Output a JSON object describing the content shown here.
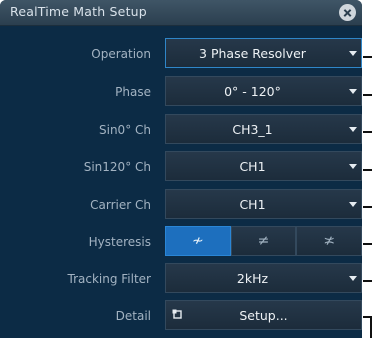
{
  "title": "RealTime Math Setup",
  "rows": [
    {
      "label": "Operation",
      "value": "3 Phase Resolver"
    },
    {
      "label": "Phase",
      "value": "0° - 120°"
    },
    {
      "label": "Sin0° Ch",
      "value": "CH3_1"
    },
    {
      "label": "Sin120° Ch",
      "value": "CH1"
    },
    {
      "label": "Carrier Ch",
      "value": "CH1"
    },
    {
      "label": "Hysteresis",
      "options": [
        "≁",
        "≠",
        "≭"
      ],
      "selected_index": 0
    },
    {
      "label": "Tracking Filter",
      "value": "2kHz"
    },
    {
      "label": "Detail",
      "value": "Setup..."
    }
  ],
  "icons": {
    "close": "close-icon",
    "dropdown": "chevron-down-icon",
    "setup": "setup-icon"
  },
  "colors": {
    "background": "#0c2b45",
    "active_border": "#2f86c8",
    "selected_segment": "#1d6fbe"
  }
}
